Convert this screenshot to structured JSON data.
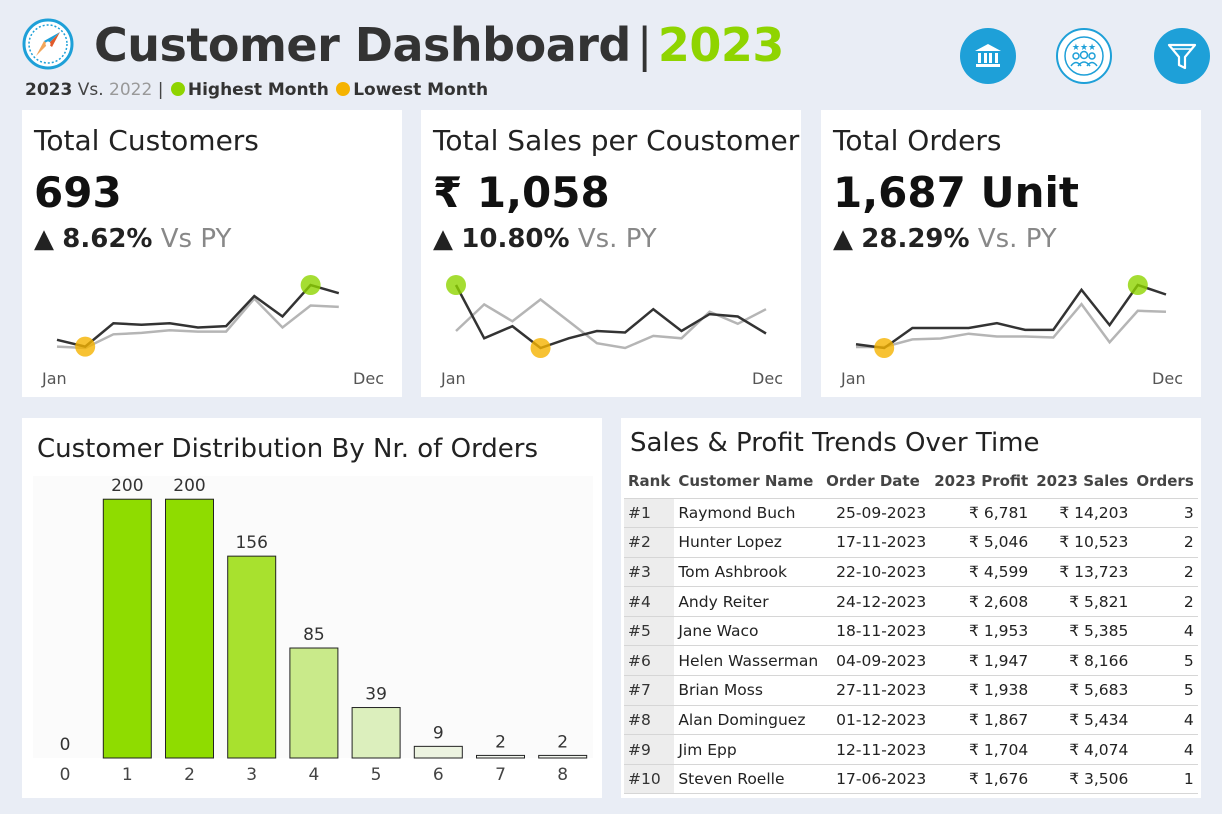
{
  "header": {
    "title": "Customer Dashboard",
    "separator": "|",
    "year": "2023",
    "subtitle": {
      "current": "2023",
      "vs": "Vs.",
      "previous": "2022",
      "bar": "|",
      "highest_label": "Highest Month",
      "lowest_label": "Lowest Month"
    },
    "buttons": [
      {
        "icon": "bank-icon"
      },
      {
        "icon": "customers-icon"
      },
      {
        "icon": "filter-icon"
      }
    ]
  },
  "colors": {
    "accent_green": "#8fd400",
    "highest": "#8fd400",
    "lowest": "#f5b300",
    "current_line": "#333333",
    "previous_line": "#b5b5b5",
    "icon_blue": "#1ea0d8"
  },
  "kpis": [
    {
      "title": "Total Customers",
      "value": "693",
      "arrow": "▲",
      "delta": "8.62%",
      "vs": "Vs PY",
      "axis_start": "Jan",
      "axis_end": "Dec",
      "current": [
        48,
        43,
        60,
        59,
        60,
        57,
        58,
        80,
        65,
        88,
        82,
        null
      ],
      "previous": [
        43,
        42,
        52,
        53,
        55,
        54,
        54,
        78,
        57,
        73,
        72,
        null
      ]
    },
    {
      "title": "Total Sales per Coustomer",
      "value": "₹ 1,058",
      "arrow": "▲",
      "delta": "10.80%",
      "vs": "Vs. PY",
      "axis_start": "Jan",
      "axis_end": "Dec",
      "current": [
        1150,
        1040,
        1065,
        1020,
        1040,
        1055,
        1052,
        1100,
        1055,
        1090,
        1085,
        1050
      ],
      "previous": [
        1055,
        1110,
        1075,
        1120,
        1075,
        1030,
        1020,
        1045,
        1040,
        1095,
        1070,
        1100
      ]
    },
    {
      "title": "Total Orders",
      "value": "1,687 Unit",
      "arrow": "▲",
      "delta": "28.29%",
      "vs": "Vs. PY",
      "axis_start": "Jan",
      "axis_end": "Dec",
      "current": [
        98,
        94,
        115,
        115,
        115,
        120,
        113,
        113,
        155,
        118,
        160,
        150
      ],
      "previous": [
        95,
        95,
        103,
        104,
        109,
        106,
        106,
        105,
        140,
        100,
        133,
        132
      ]
    }
  ],
  "distribution": {
    "title": "Customer Distribution By Nr. of Orders"
  },
  "chart_data": {
    "type": "bar",
    "title": "Customer Distribution By Nr. of Orders",
    "categories": [
      "0",
      "1",
      "2",
      "3",
      "4",
      "5",
      "6",
      "7",
      "8"
    ],
    "values": [
      0,
      200,
      200,
      156,
      85,
      39,
      9,
      2,
      2
    ],
    "colors": [
      "#8fdc00",
      "#8fdc00",
      "#8fdc00",
      "#a8e12e",
      "#c9ea8a",
      "#dcefbd",
      "#ecf3e0",
      "#f2f5ee",
      "#f2f5ee"
    ],
    "xlabel": "",
    "ylabel": "",
    "ylim": [
      0,
      215
    ],
    "grid": false
  },
  "table": {
    "title": "Sales & Profit Trends Over Time",
    "headers": {
      "rank": "Rank",
      "name": "Customer Name",
      "date": "Order Date",
      "profit": "2023 Profit",
      "sales": "2023 Sales",
      "orders": "Orders"
    },
    "rows": [
      {
        "rank": "#1",
        "name": "Raymond Buch",
        "date": "25-09-2023",
        "profit": "₹ 6,781",
        "sales": "₹ 14,203",
        "orders": "3"
      },
      {
        "rank": "#2",
        "name": "Hunter Lopez",
        "date": "17-11-2023",
        "profit": "₹ 5,046",
        "sales": "₹ 10,523",
        "orders": "2"
      },
      {
        "rank": "#3",
        "name": "Tom Ashbrook",
        "date": "22-10-2023",
        "profit": "₹ 4,599",
        "sales": "₹ 13,723",
        "orders": "2"
      },
      {
        "rank": "#4",
        "name": "Andy Reiter",
        "date": "24-12-2023",
        "profit": "₹ 2,608",
        "sales": "₹ 5,821",
        "orders": "2"
      },
      {
        "rank": "#5",
        "name": "Jane Waco",
        "date": "18-11-2023",
        "profit": "₹ 1,953",
        "sales": "₹ 5,385",
        "orders": "4"
      },
      {
        "rank": "#6",
        "name": "Helen Wasserman",
        "date": "04-09-2023",
        "profit": "₹ 1,947",
        "sales": "₹ 8,166",
        "orders": "5"
      },
      {
        "rank": "#7",
        "name": "Brian Moss",
        "date": "27-11-2023",
        "profit": "₹ 1,938",
        "sales": "₹ 5,683",
        "orders": "5"
      },
      {
        "rank": "#8",
        "name": "Alan Dominguez",
        "date": "01-12-2023",
        "profit": "₹ 1,867",
        "sales": "₹ 5,434",
        "orders": "4"
      },
      {
        "rank": "#9",
        "name": "Jim Epp",
        "date": "12-11-2023",
        "profit": "₹ 1,704",
        "sales": "₹ 4,074",
        "orders": "4"
      },
      {
        "rank": "#10",
        "name": "Steven Roelle",
        "date": "17-06-2023",
        "profit": "₹ 1,676",
        "sales": "₹ 3,506",
        "orders": "1"
      }
    ]
  }
}
